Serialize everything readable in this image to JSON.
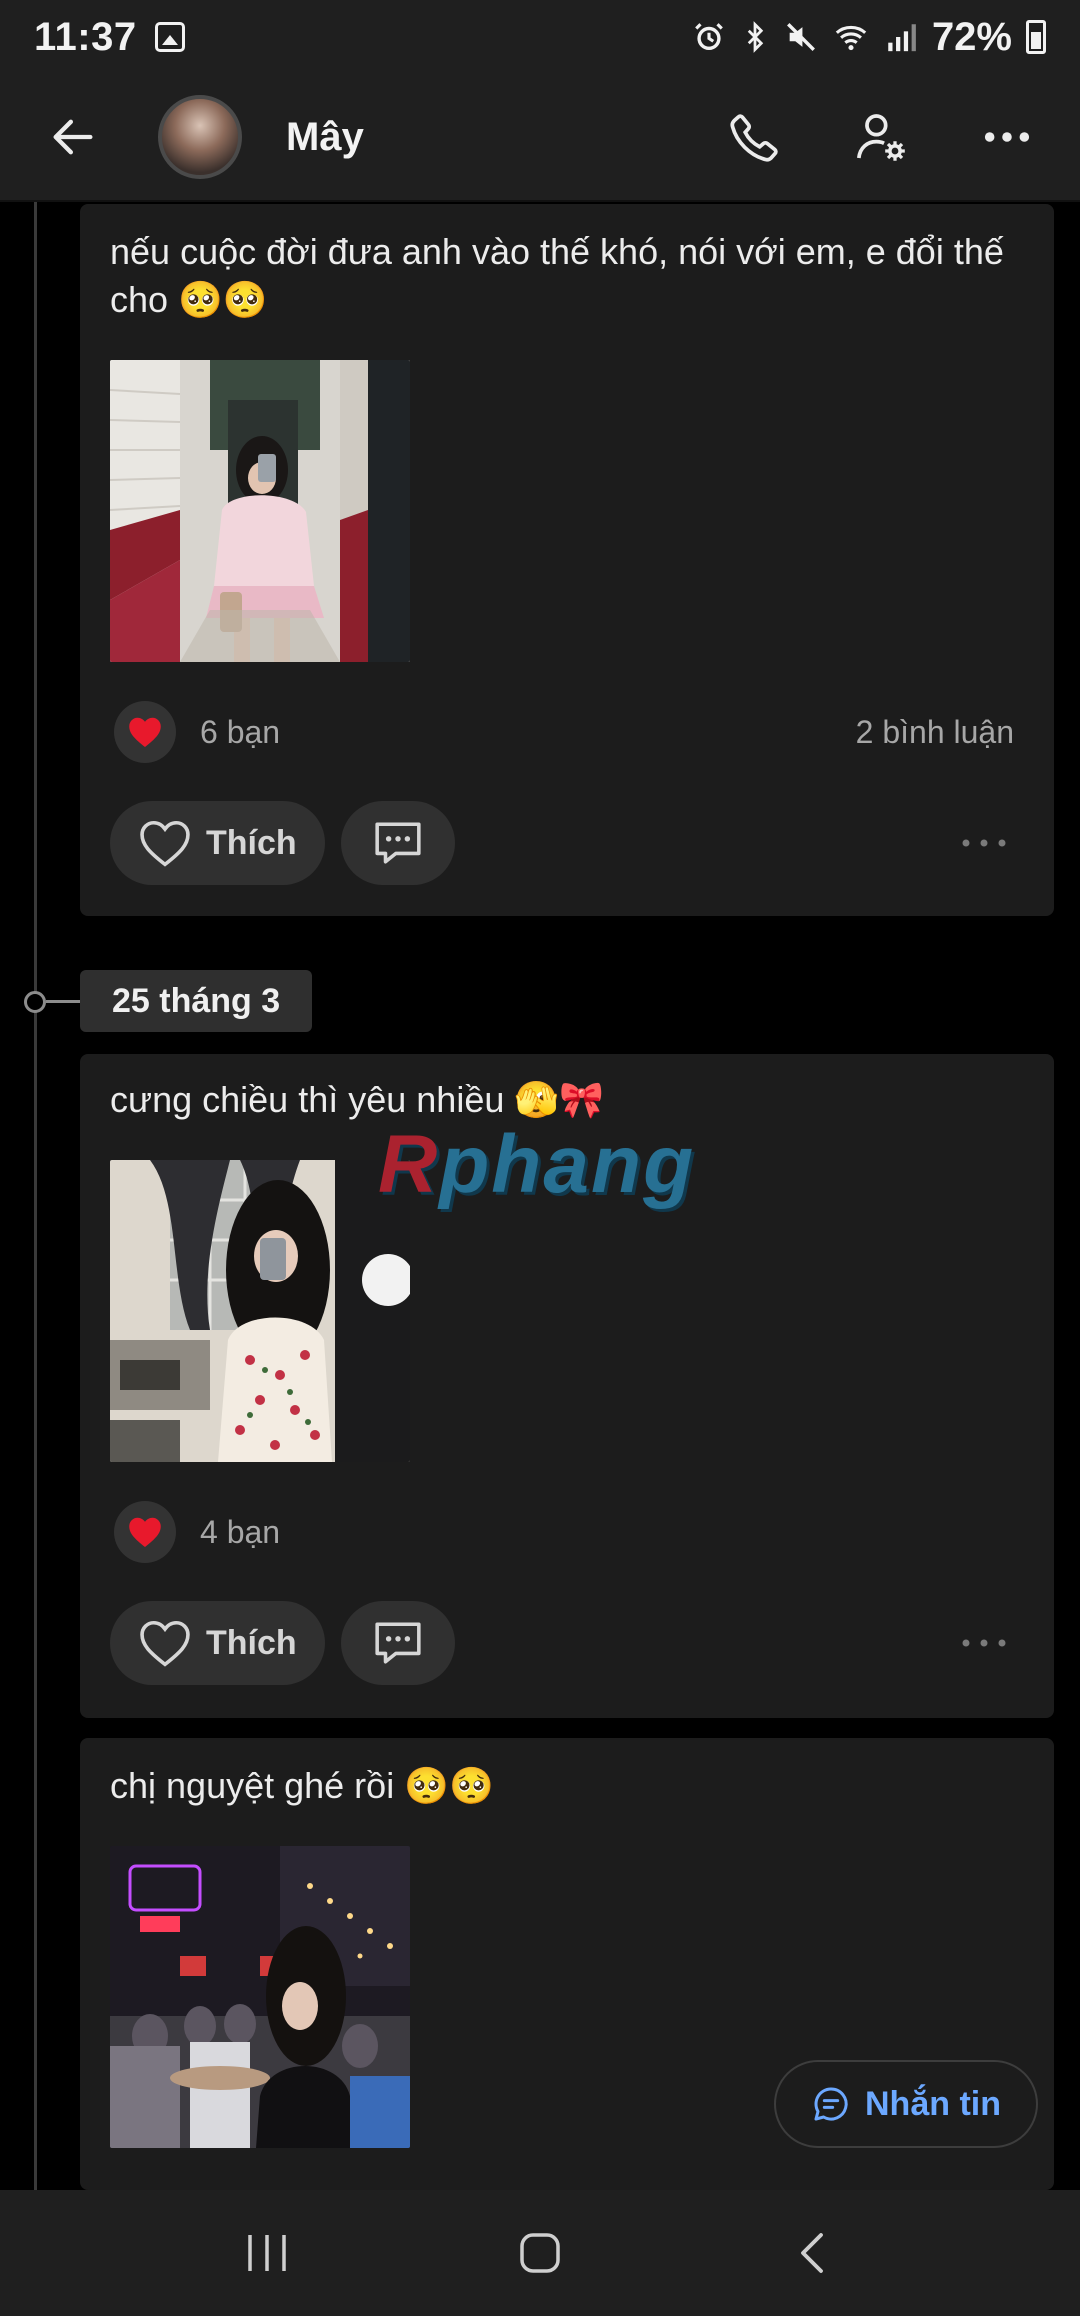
{
  "status_bar": {
    "time": "11:37",
    "battery": "72%",
    "icons": [
      "image-icon",
      "alarm-icon",
      "bluetooth-icon",
      "mute-icon",
      "wifi-icon",
      "signal-icon",
      "battery-icon"
    ]
  },
  "header": {
    "contact_name": "Mây",
    "actions": [
      "phone-icon",
      "user-settings-icon",
      "more-icon"
    ]
  },
  "timeline": {
    "date_separator": "25 tháng 3"
  },
  "posts": [
    {
      "text": "nếu cuộc đời đưa anh vào thế khó, nói với em, e đổi thế cho 🥺🥺",
      "reactions": "6 bạn",
      "comments": "2 bình luận",
      "like_label": "Thích"
    },
    {
      "text": "cưng chiều thì yêu nhiều 🫣🎀",
      "reactions": "4 bạn",
      "like_label": "Thích"
    },
    {
      "text": "chị nguyệt ghé rồi 🥺🥺"
    }
  ],
  "watermark": {
    "first": "R",
    "rest": "phang"
  },
  "fab": {
    "label": "Nhắn tin"
  },
  "colors": {
    "accent": "#6ca8ff",
    "heart": "#e8192c",
    "card": "#1c1c1c",
    "background": "#000000"
  }
}
